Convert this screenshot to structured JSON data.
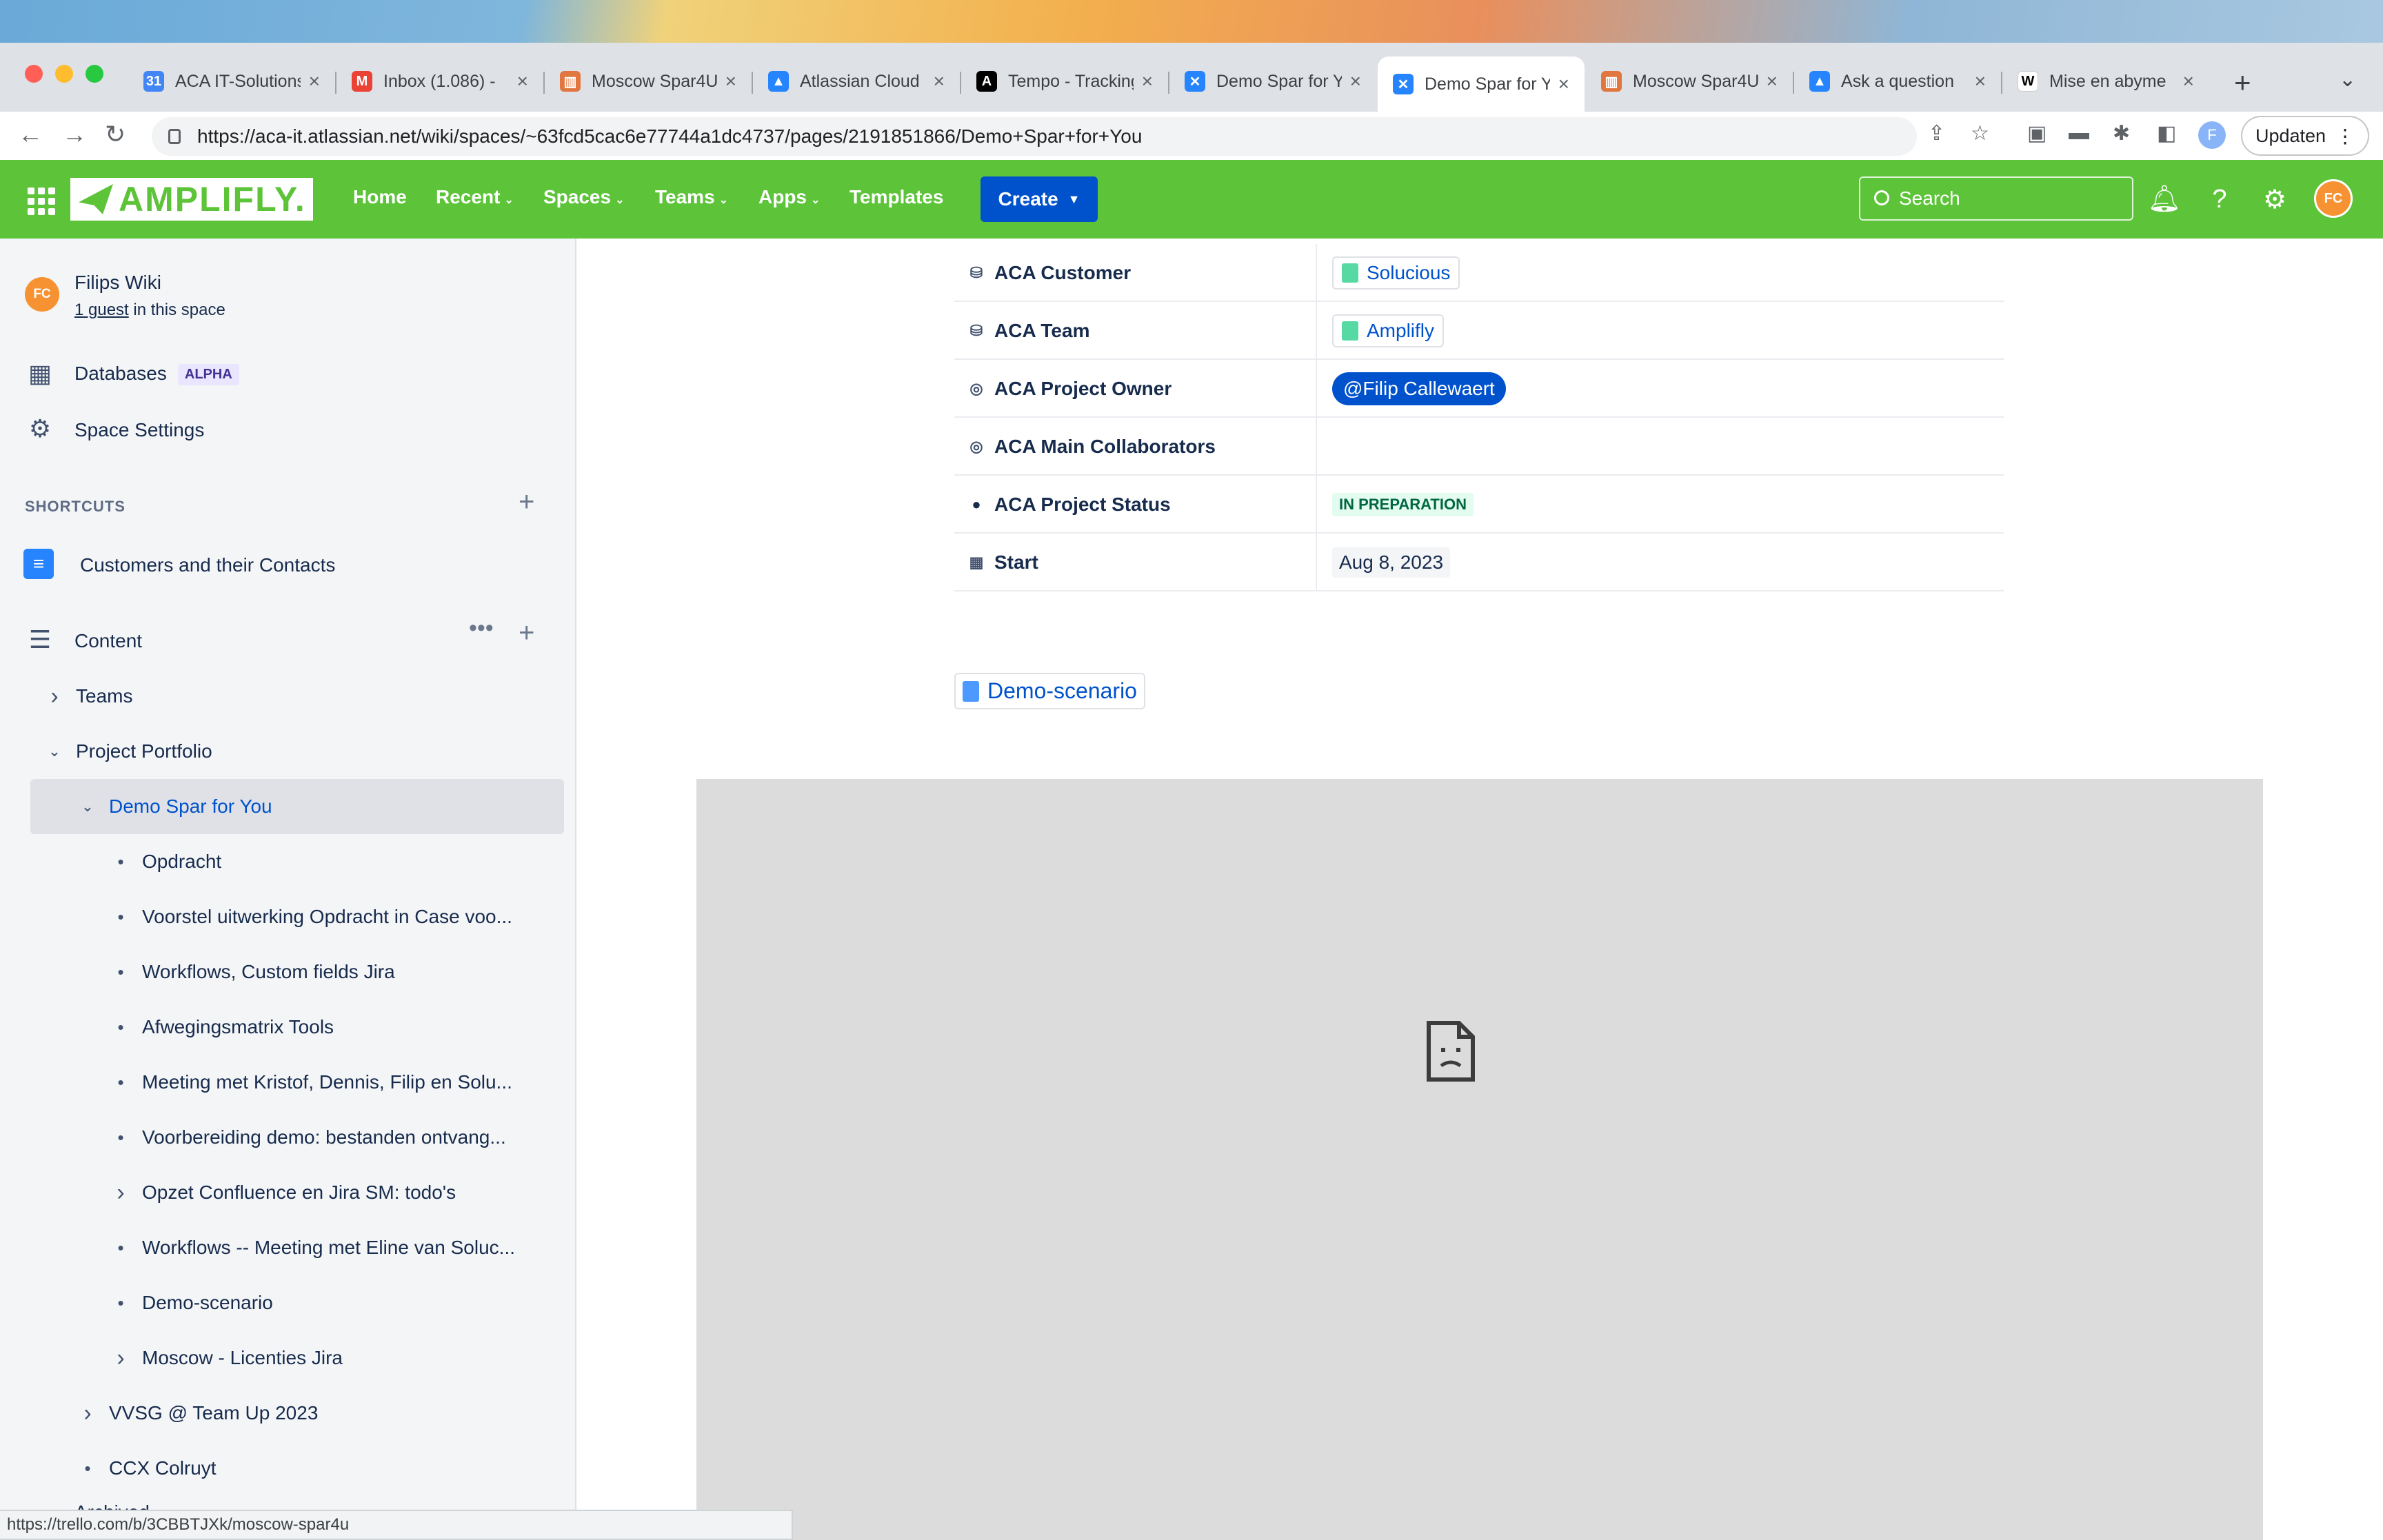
{
  "browser": {
    "tabs": [
      {
        "title": "ACA IT-Solutions",
        "favicon_color": "#4285f4",
        "favicon_glyph": "calendar-icon"
      },
      {
        "title": "Inbox (1.086) -",
        "favicon_color": "#ea4335",
        "favicon_glyph": "gmail-icon"
      },
      {
        "title": "Moscow Spar4U",
        "favicon_color": "#e2763f",
        "favicon_glyph": "trello-icon"
      },
      {
        "title": "Atlassian Cloud",
        "favicon_color": "#2684ff",
        "favicon_glyph": "atlassian-icon"
      },
      {
        "title": "Tempo - Tracking",
        "favicon_color": "#000000",
        "favicon_glyph": "tempo-icon"
      },
      {
        "title": "Demo Spar for You",
        "favicon_color": "#2684ff",
        "favicon_glyph": "confluence-icon"
      },
      {
        "title": "Demo Spar for You",
        "favicon_color": "#2684ff",
        "favicon_glyph": "confluence-icon",
        "active": true
      },
      {
        "title": "Moscow Spar4U",
        "favicon_color": "#e2763f",
        "favicon_glyph": "trello-icon"
      },
      {
        "title": "Ask a question",
        "favicon_color": "#2684ff",
        "favicon_glyph": "atlassian-icon"
      },
      {
        "title": "Mise en abyme",
        "favicon_color": "#ffffff",
        "favicon_glyph": "wikipedia-icon"
      }
    ],
    "url": "https://aca-it.atlassian.net/wiki/spaces/~63fcd5cac6e77744a1dc4737/pages/2191851866/Demo+Spar+for+You",
    "update_label": "Updaten",
    "profile_initial": "F",
    "status_url": "https://trello.com/b/3CBBTJXk/moscow-spar4u"
  },
  "appbar": {
    "logo_text": "AMPLIFLY.",
    "nav": [
      "Home",
      "Recent",
      "Spaces",
      "Teams",
      "Apps",
      "Templates"
    ],
    "create_label": "Create",
    "search_placeholder": "Search",
    "avatar_initials": "FC",
    "brand_color": "#5dc43a"
  },
  "sidebar": {
    "space_name": "Filips Wiki",
    "guest_link": "1 guest",
    "guest_suffix": " in this space",
    "avatar_initials": "FC",
    "databases_label": "Databases",
    "databases_badge": "ALPHA",
    "settings_label": "Space Settings",
    "shortcuts_title": "SHORTCUTS",
    "shortcut_item": "Customers and their Contacts",
    "content_label": "Content",
    "tree": [
      {
        "label": "Teams",
        "level": 0,
        "kind": "chevron-right"
      },
      {
        "label": "Project Portfolio",
        "level": 0,
        "kind": "chevron-down"
      },
      {
        "label": "Demo Spar for You",
        "level": 1,
        "kind": "chevron-down",
        "selected": true
      },
      {
        "label": "Opdracht",
        "level": 2,
        "kind": "bullet"
      },
      {
        "label": "Voorstel uitwerking Opdracht in Case voo...",
        "level": 2,
        "kind": "bullet"
      },
      {
        "label": "Workflows, Custom fields Jira",
        "level": 2,
        "kind": "bullet"
      },
      {
        "label": "Afwegingsmatrix Tools",
        "level": 2,
        "kind": "bullet"
      },
      {
        "label": "Meeting met Kristof, Dennis, Filip en Solu...",
        "level": 2,
        "kind": "bullet"
      },
      {
        "label": "Voorbereiding demo: bestanden ontvang...",
        "level": 2,
        "kind": "bullet"
      },
      {
        "label": "Opzet Confluence en Jira SM: todo's",
        "level": 2,
        "kind": "chevron-right"
      },
      {
        "label": "Workflows -- Meeting met Eline van Soluc...",
        "level": 2,
        "kind": "bullet"
      },
      {
        "label": "Demo-scenario",
        "level": 2,
        "kind": "bullet"
      },
      {
        "label": "Moscow - Licenties Jira",
        "level": 2,
        "kind": "chevron-right"
      },
      {
        "label": "VVSG @ Team Up 2023",
        "level": 1,
        "kind": "chevron-right"
      },
      {
        "label": "CCX Colruyt",
        "level": 1,
        "kind": "bullet"
      }
    ],
    "archived_label": "Archived"
  },
  "page": {
    "properties": [
      {
        "key": "ACA Customer",
        "icon": "database-icon",
        "type": "page",
        "value": "Solucious"
      },
      {
        "key": "ACA Team",
        "icon": "database-icon",
        "type": "page",
        "value": "Amplifly"
      },
      {
        "key": "ACA Project Owner",
        "icon": "mention-icon",
        "type": "mention",
        "value": "@Filip Callewaert"
      },
      {
        "key": "ACA Main Collaborators",
        "icon": "mention-icon",
        "type": "empty",
        "value": ""
      },
      {
        "key": "ACA Project Status",
        "icon": "status-icon",
        "type": "status",
        "value": "IN PREPARATION"
      },
      {
        "key": "Start",
        "icon": "calendar-icon",
        "type": "date",
        "value": "Aug 8, 2023"
      }
    ],
    "doc_link": "Demo-scenario"
  }
}
